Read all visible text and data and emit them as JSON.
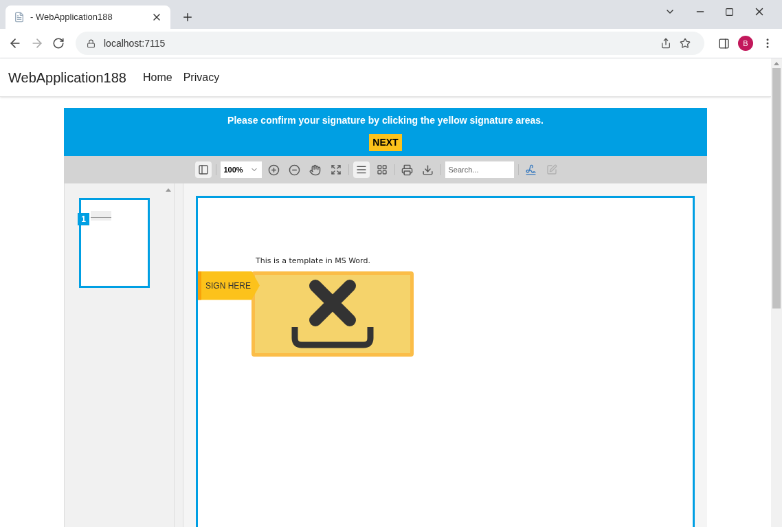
{
  "browser": {
    "tab_title": "- WebApplication188",
    "address": "localhost:7115",
    "avatar_letter": "B"
  },
  "navbar": {
    "brand": "WebApplication188",
    "links": [
      "Home",
      "Privacy"
    ]
  },
  "banner": {
    "message": "Please confirm your signature by clicking the yellow signature areas.",
    "button": "NEXT"
  },
  "toolbar": {
    "sidebar_toggle": {
      "selected": true
    },
    "zoom": "100%",
    "search": {
      "placeholder": "Search..."
    },
    "view_buttons": [
      {
        "kind": "single",
        "selected": true
      },
      {
        "kind": "grid",
        "selected": false
      }
    ],
    "form_button": {
      "disabled": true
    }
  },
  "thumbnails": [
    {
      "number": "1",
      "selected": true
    }
  ],
  "document": {
    "text": "This is a template in MS Word.",
    "sign_label": "SIGN HERE"
  }
}
